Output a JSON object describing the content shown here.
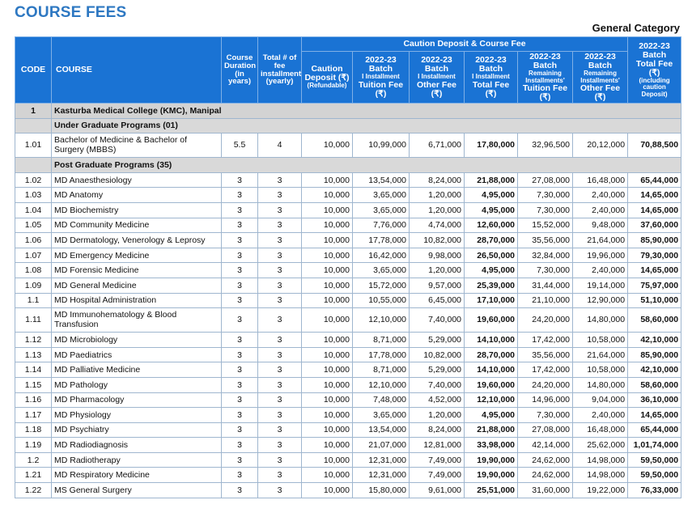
{
  "title": "COURSE FEES",
  "category": "General Category",
  "headers": {
    "code": "CODE",
    "course": "COURSE",
    "duration": "Course Duration (in years)",
    "installments": "Total # of fee installments (yearly)",
    "group": "Caution Deposit & Course Fee",
    "caution": "Caution Deposit (₹)",
    "caution_sub": "(Refundable)",
    "batch": "2022-23 Batch",
    "i_installment": "I Installment",
    "remaining": "Remaining Installments'",
    "tuition": "Tuition Fee (₹)",
    "other": "Other Fee (₹)",
    "total": "Total Fee (₹)",
    "total_sub": "(including caution Deposit)"
  },
  "section": {
    "code": "1",
    "label": "Kasturba Medical College (KMC), Manipal"
  },
  "ug_label": "Under Graduate Programs (01)",
  "ug_rows": [
    [
      "1.01",
      "Bachelor of Medicine & Bachelor of Surgery (MBBS)",
      "5.5",
      "4",
      "10,000",
      "10,99,000",
      "6,71,000",
      "17,80,000",
      "32,96,500",
      "20,12,000",
      "70,88,500"
    ]
  ],
  "pg_label": "Post Graduate Programs (35)",
  "pg_rows": [
    [
      "1.02",
      "MD Anaesthesiology",
      "3",
      "3",
      "10,000",
      "13,54,000",
      "8,24,000",
      "21,88,000",
      "27,08,000",
      "16,48,000",
      "65,44,000"
    ],
    [
      "1.03",
      "MD Anatomy",
      "3",
      "3",
      "10,000",
      "3,65,000",
      "1,20,000",
      "4,95,000",
      "7,30,000",
      "2,40,000",
      "14,65,000"
    ],
    [
      "1.04",
      "MD Biochemistry",
      "3",
      "3",
      "10,000",
      "3,65,000",
      "1,20,000",
      "4,95,000",
      "7,30,000",
      "2,40,000",
      "14,65,000"
    ],
    [
      "1.05",
      "MD Community Medicine",
      "3",
      "3",
      "10,000",
      "7,76,000",
      "4,74,000",
      "12,60,000",
      "15,52,000",
      "9,48,000",
      "37,60,000"
    ],
    [
      "1.06",
      "MD Dermatology, Venerology & Leprosy",
      "3",
      "3",
      "10,000",
      "17,78,000",
      "10,82,000",
      "28,70,000",
      "35,56,000",
      "21,64,000",
      "85,90,000"
    ],
    [
      "1.07",
      "MD Emergency Medicine",
      "3",
      "3",
      "10,000",
      "16,42,000",
      "9,98,000",
      "26,50,000",
      "32,84,000",
      "19,96,000",
      "79,30,000"
    ],
    [
      "1.08",
      "MD Forensic Medicine",
      "3",
      "3",
      "10,000",
      "3,65,000",
      "1,20,000",
      "4,95,000",
      "7,30,000",
      "2,40,000",
      "14,65,000"
    ],
    [
      "1.09",
      "MD General Medicine",
      "3",
      "3",
      "10,000",
      "15,72,000",
      "9,57,000",
      "25,39,000",
      "31,44,000",
      "19,14,000",
      "75,97,000"
    ],
    [
      "1.1",
      "MD Hospital Administration",
      "3",
      "3",
      "10,000",
      "10,55,000",
      "6,45,000",
      "17,10,000",
      "21,10,000",
      "12,90,000",
      "51,10,000"
    ],
    [
      "1.11",
      "MD Immunohematology & Blood Transfusion",
      "3",
      "3",
      "10,000",
      "12,10,000",
      "7,40,000",
      "19,60,000",
      "24,20,000",
      "14,80,000",
      "58,60,000"
    ],
    [
      "1.12",
      "MD Microbiology",
      "3",
      "3",
      "10,000",
      "8,71,000",
      "5,29,000",
      "14,10,000",
      "17,42,000",
      "10,58,000",
      "42,10,000"
    ],
    [
      "1.13",
      "MD Paediatrics",
      "3",
      "3",
      "10,000",
      "17,78,000",
      "10,82,000",
      "28,70,000",
      "35,56,000",
      "21,64,000",
      "85,90,000"
    ],
    [
      "1.14",
      "MD Palliative Medicine",
      "3",
      "3",
      "10,000",
      "8,71,000",
      "5,29,000",
      "14,10,000",
      "17,42,000",
      "10,58,000",
      "42,10,000"
    ],
    [
      "1.15",
      "MD Pathology",
      "3",
      "3",
      "10,000",
      "12,10,000",
      "7,40,000",
      "19,60,000",
      "24,20,000",
      "14,80,000",
      "58,60,000"
    ],
    [
      "1.16",
      "MD Pharmacology",
      "3",
      "3",
      "10,000",
      "7,48,000",
      "4,52,000",
      "12,10,000",
      "14,96,000",
      "9,04,000",
      "36,10,000"
    ],
    [
      "1.17",
      "MD Physiology",
      "3",
      "3",
      "10,000",
      "3,65,000",
      "1,20,000",
      "4,95,000",
      "7,30,000",
      "2,40,000",
      "14,65,000"
    ],
    [
      "1.18",
      "MD Psychiatry",
      "3",
      "3",
      "10,000",
      "13,54,000",
      "8,24,000",
      "21,88,000",
      "27,08,000",
      "16,48,000",
      "65,44,000"
    ],
    [
      "1.19",
      "MD Radiodiagnosis",
      "3",
      "3",
      "10,000",
      "21,07,000",
      "12,81,000",
      "33,98,000",
      "42,14,000",
      "25,62,000",
      "1,01,74,000"
    ],
    [
      "1.2",
      "MD Radiotherapy",
      "3",
      "3",
      "10,000",
      "12,31,000",
      "7,49,000",
      "19,90,000",
      "24,62,000",
      "14,98,000",
      "59,50,000"
    ],
    [
      "1.21",
      "MD Respiratory Medicine",
      "3",
      "3",
      "10,000",
      "12,31,000",
      "7,49,000",
      "19,90,000",
      "24,62,000",
      "14,98,000",
      "59,50,000"
    ],
    [
      "1.22",
      "MS General Surgery",
      "3",
      "3",
      "10,000",
      "15,80,000",
      "9,61,000",
      "25,51,000",
      "31,60,000",
      "19,22,000",
      "76,33,000"
    ]
  ]
}
